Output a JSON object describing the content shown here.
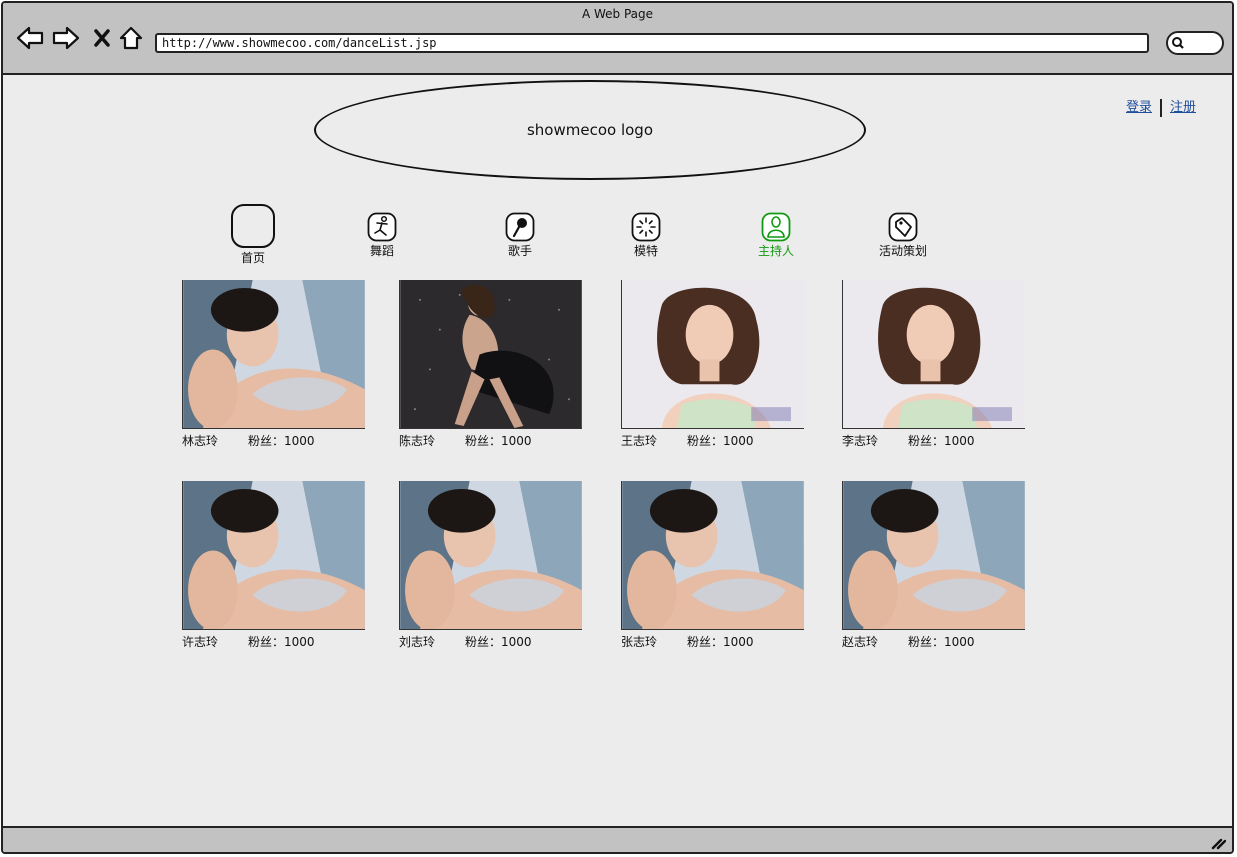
{
  "window": {
    "title": "A Web Page"
  },
  "browser": {
    "url": "http://www.showmecoo.com/danceList.jsp"
  },
  "auth": {
    "login": "登录",
    "register": "注册"
  },
  "logo": {
    "text": "showmecoo logo"
  },
  "nav": [
    {
      "label": "首页",
      "icon": "blank-rounded-square-icon",
      "active": false
    },
    {
      "label": "舞蹈",
      "icon": "dancer-icon",
      "active": false
    },
    {
      "label": "歌手",
      "icon": "microphone-icon",
      "active": false
    },
    {
      "label": "模特",
      "icon": "sparkle-icon",
      "active": false
    },
    {
      "label": "主持人",
      "icon": "person-icon",
      "active": true
    },
    {
      "label": "活动策划",
      "icon": "tag-icon",
      "active": false
    }
  ],
  "accent_color": "#119a11",
  "fans_label": "粉丝：",
  "performers": [
    {
      "name": "林志玲",
      "fans": "1000",
      "photo": "bikini"
    },
    {
      "name": "陈志玲",
      "fans": "1000",
      "photo": "dark-dress"
    },
    {
      "name": "王志玲",
      "fans": "1000",
      "photo": "portrait"
    },
    {
      "name": "李志玲",
      "fans": "1000",
      "photo": "portrait"
    },
    {
      "name": "许志玲",
      "fans": "1000",
      "photo": "bikini"
    },
    {
      "name": "刘志玲",
      "fans": "1000",
      "photo": "bikini"
    },
    {
      "name": "张志玲",
      "fans": "1000",
      "photo": "bikini"
    },
    {
      "name": "赵志玲",
      "fans": "1000",
      "photo": "bikini"
    }
  ]
}
